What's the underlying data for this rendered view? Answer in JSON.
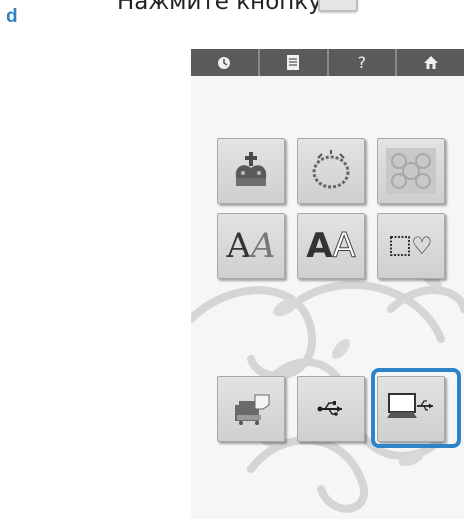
{
  "step": {
    "label": "d"
  },
  "instruction": {
    "text": "Нажмите кнопку"
  },
  "topbar": {
    "buttons": [
      {
        "name": "clock-icon",
        "glyph": "◉"
      },
      {
        "name": "document-icon",
        "glyph": "▤"
      },
      {
        "name": "help-icon",
        "glyph": "?"
      },
      {
        "name": "home-icon",
        "glyph": "⌂"
      }
    ]
  },
  "tiles": {
    "row1": [
      "crown-icon",
      "wreath-icon",
      "quilt-pattern-icon"
    ],
    "row2_text": {
      "alpha_left": "A",
      "alpha_left2": "A",
      "alpha_right": "A",
      "alpha_right2": "A",
      "heart": "♡"
    },
    "row3": [
      "sewing-machine-icon",
      "usb-icon",
      "computer-usb-icon"
    ]
  },
  "colors": {
    "accent": "#2f83c8",
    "topbar": "#5a5a5a",
    "tile": "#d9d9d9",
    "background": "#f6f6f6"
  }
}
